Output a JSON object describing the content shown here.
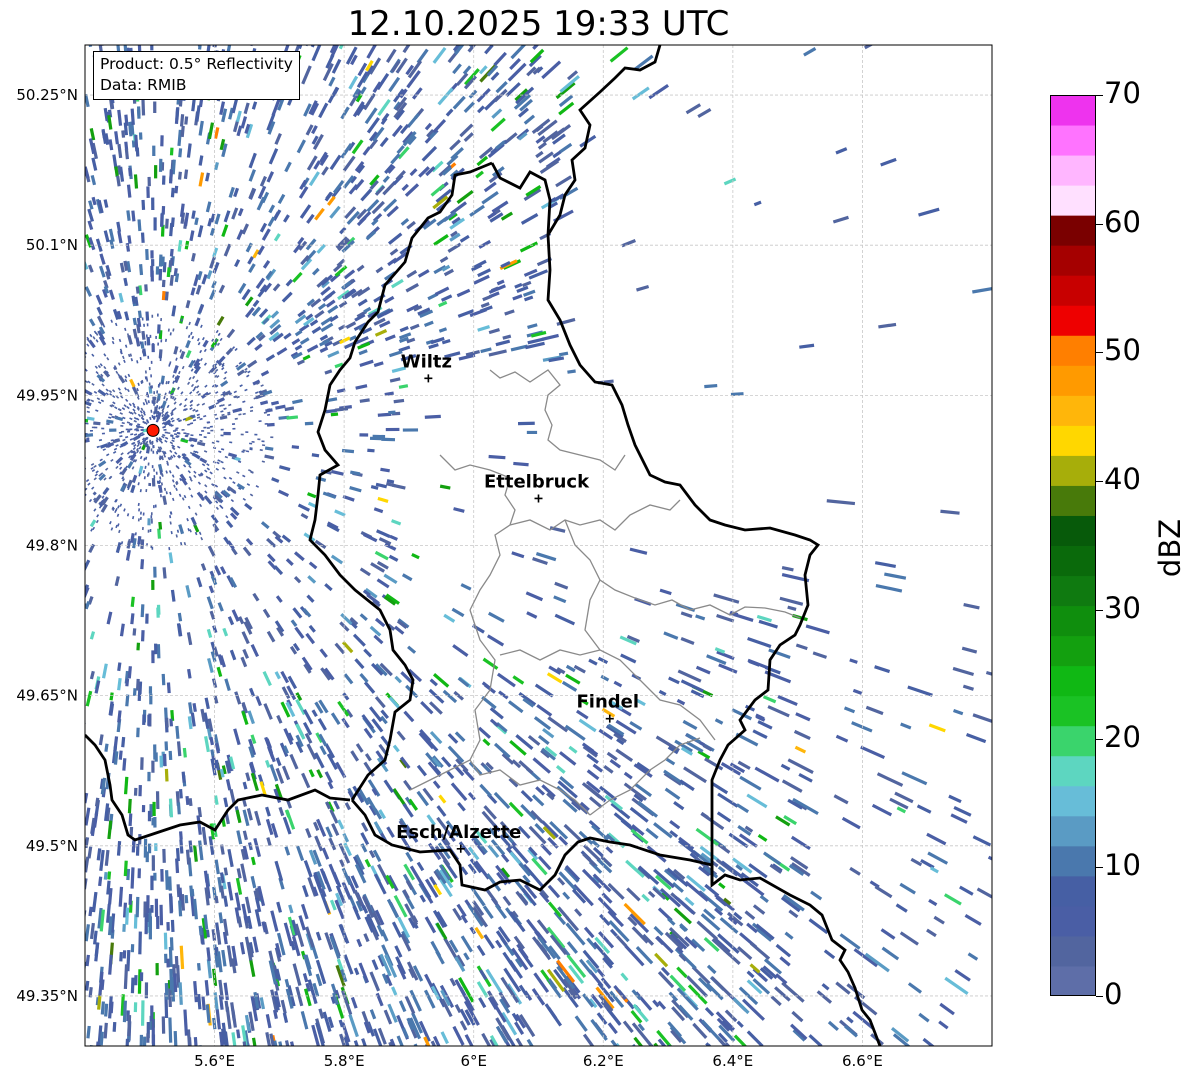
{
  "title": "12.10.2025 19:33 UTC",
  "info": {
    "product": "Product: 0.5° Reflectivity",
    "data": "Data: RMIB"
  },
  "map_extent": {
    "lon_min": 5.4,
    "lon_max": 6.8,
    "lat_min": 49.3,
    "lat_max": 50.3
  },
  "lat_ticks": [
    {
      "value": 50.25,
      "label": "50.25°N"
    },
    {
      "value": 50.1,
      "label": "50.1°N"
    },
    {
      "value": 49.95,
      "label": "49.95°N"
    },
    {
      "value": 49.8,
      "label": "49.8°N"
    },
    {
      "value": 49.65,
      "label": "49.65°N"
    },
    {
      "value": 49.5,
      "label": "49.5°N"
    },
    {
      "value": 49.35,
      "label": "49.35°N"
    }
  ],
  "lon_ticks": [
    {
      "value": 5.6,
      "label": "5.6°E"
    },
    {
      "value": 5.8,
      "label": "5.8°E"
    },
    {
      "value": 6.0,
      "label": "6°E"
    },
    {
      "value": 6.2,
      "label": "6.2°E"
    },
    {
      "value": 6.4,
      "label": "6.4°E"
    },
    {
      "value": 6.6,
      "label": "6.6°E"
    }
  ],
  "cities": [
    {
      "name": "Wiltz",
      "lon": 5.93,
      "lat": 49.967
    },
    {
      "name": "Ettelbruck",
      "lon": 6.1,
      "lat": 49.847
    },
    {
      "name": "Findel",
      "lon": 6.21,
      "lat": 49.627
    },
    {
      "name": "Esch/Alzette",
      "lon": 5.98,
      "lat": 49.497
    }
  ],
  "radar_site": {
    "lon": 5.505,
    "lat": 49.915,
    "color": "#ff1a00"
  },
  "colorbar": {
    "unit": "dBZ",
    "min": 0,
    "max": 70,
    "tick_labels": [
      "0",
      "10",
      "20",
      "30",
      "40",
      "50",
      "60",
      "70"
    ],
    "colors": [
      "#5e6ea8",
      "#52659f",
      "#4a5ea5",
      "#465fa4",
      "#4a78ad",
      "#5a9bc4",
      "#67bdd8",
      "#5dd6c0",
      "#3ad46c",
      "#1ac224",
      "#10b814",
      "#13a00f",
      "#0f8e0d",
      "#0f7a10",
      "#0a6a0b",
      "#075a0a",
      "#487a0a",
      "#a7ae0a",
      "#ffd700",
      "#ffb60a",
      "#ff9a00",
      "#ff7f00",
      "#ee0000",
      "#c80000",
      "#a50000",
      "#7a0000",
      "#ffe0ff",
      "#ffb6ff",
      "#ff73ff",
      "#ee33ee"
    ]
  },
  "colors": {
    "border": "#000000",
    "canton_lines": "#8a8a8a",
    "grid": "#c8c8c8",
    "echo_main": "#4f6aa8"
  }
}
